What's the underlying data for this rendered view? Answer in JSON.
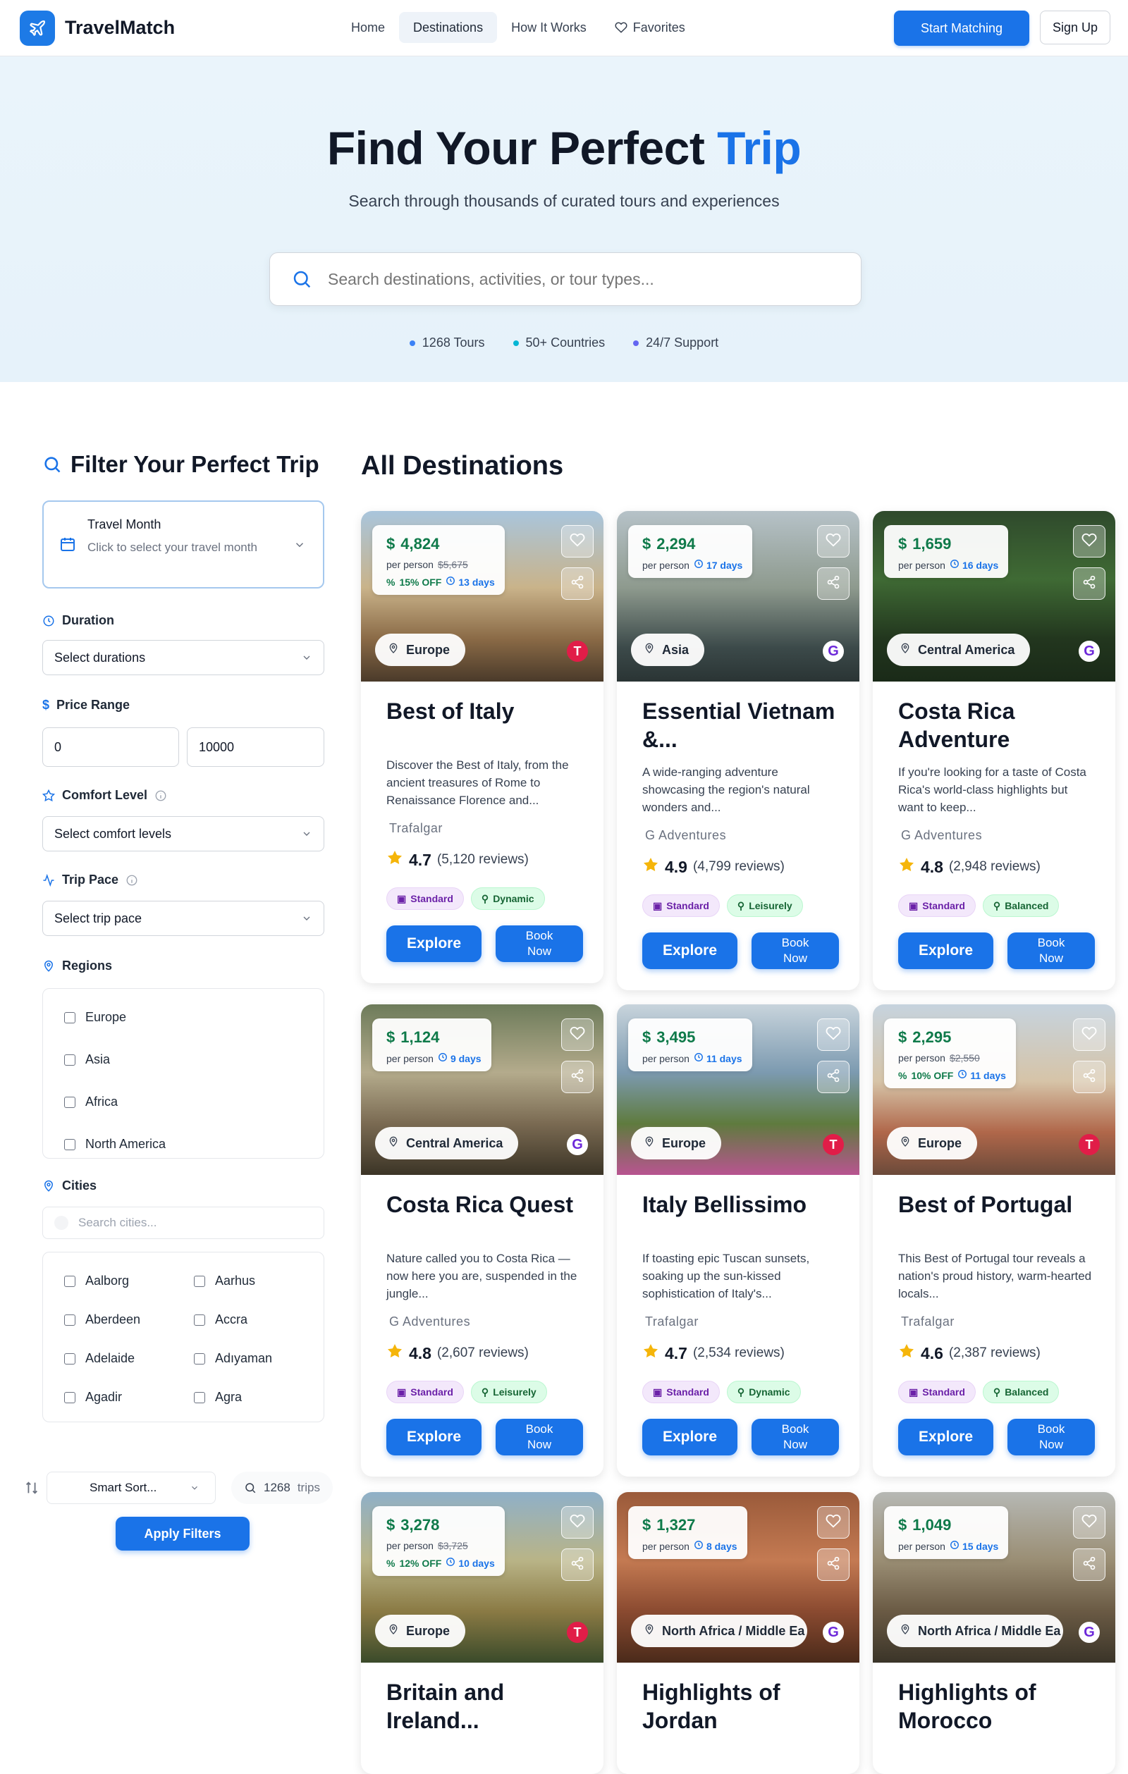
{
  "nav": {
    "brand": "TravelMatch",
    "items": [
      {
        "label": "Home"
      },
      {
        "label": "Destinations"
      },
      {
        "label": "How It Works"
      },
      {
        "label": "Favorites"
      }
    ],
    "cta": "Start Matching",
    "signup": "Sign Up"
  },
  "hero": {
    "title_main": "Find Your Perfect",
    "title_accent": "Trip",
    "subtitle": "Search through thousands of curated tours and experiences",
    "search_placeholder": "Search destinations, activities, or tour types...",
    "stats": [
      {
        "label": "1268 Tours",
        "color": "#3b82f6"
      },
      {
        "label": "50+ Countries",
        "color": "#06b6d4"
      },
      {
        "label": "24/7 Support",
        "color": "#6366f1"
      }
    ]
  },
  "filters": {
    "title": "Filter Your Perfect Trip",
    "travel_month_label": "Travel Month",
    "travel_month_value": "Click to select your travel month",
    "duration_label": "Duration",
    "duration_value": "Select durations",
    "price_label": "Price Range",
    "price_min": "0",
    "price_max": "10000",
    "comfort_label": "Comfort Level",
    "comfort_value": "Select comfort levels",
    "pace_label": "Trip Pace",
    "pace_value": "Select trip pace",
    "regions_label": "Regions",
    "regions": [
      "Europe",
      "Asia",
      "Africa",
      "North America"
    ],
    "cities_label": "Cities",
    "cities_placeholder": "Search cities...",
    "cities": [
      "Aalborg",
      "Aarhus",
      "Aberdeen",
      "Accra",
      "Adelaide",
      "Adıyaman",
      "Agadir",
      "Agra"
    ],
    "sort_value": "Smart Sort...",
    "count_num": "1268",
    "count_unit": "trips",
    "apply": "Apply Filters"
  },
  "main": {
    "title": "All Destinations",
    "explore_label": "Explore",
    "book_label": "Book Now",
    "per_person": "per person"
  },
  "cards": [
    {
      "price": "4,824",
      "old_price": "$5,675",
      "discount": "15% OFF",
      "days": "13 days",
      "region": "Europe",
      "operator_badge": "T",
      "title": "Best of Italy",
      "description": "Discover the Best of Italy, from the ancient treasures of Rome to Renaissance Florence and...",
      "operator": "Trafalgar",
      "rating": "4.7",
      "reviews": "(5,120 reviews)",
      "comfort": "Standard",
      "pace": "Dynamic",
      "theme": "italy"
    },
    {
      "price": "2,294",
      "old_price": "",
      "discount": "",
      "days": "17 days",
      "region": "Asia",
      "operator_badge": "G",
      "title": "Essential Vietnam &...",
      "description": "A wide-ranging adventure showcasing the region's natural wonders and...",
      "operator": "G Adventures",
      "rating": "4.9",
      "reviews": "(4,799 reviews)",
      "comfort": "Standard",
      "pace": "Leisurely",
      "theme": "vietnam"
    },
    {
      "price": "1,659",
      "old_price": "",
      "discount": "",
      "days": "16 days",
      "region": "Central America",
      "operator_badge": "G",
      "title": "Costa Rica Adventure",
      "description": "If you're looking for a taste of Costa Rica's world-class highlights but want to keep...",
      "operator": "G Adventures",
      "rating": "4.8",
      "reviews": "(2,948 reviews)",
      "comfort": "Standard",
      "pace": "Balanced",
      "theme": "forest"
    },
    {
      "price": "1,124",
      "old_price": "",
      "discount": "",
      "days": "9 days",
      "region": "Central America",
      "operator_badge": "G",
      "title": "Costa Rica Quest",
      "description": "Nature called you to Costa Rica — now here you are, suspended in the jungle...",
      "operator": "G Adventures",
      "rating": "4.8",
      "reviews": "(2,607 reviews)",
      "comfort": "Standard",
      "pace": "Leisurely",
      "theme": "quest"
    },
    {
      "price": "3,495",
      "old_price": "",
      "discount": "",
      "days": "11 days",
      "region": "Europe",
      "operator_badge": "T",
      "title": "Italy Bellissimo",
      "description": "If toasting epic Tuscan sunsets, soaking up the sun-kissed sophistication of Italy's...",
      "operator": "Trafalgar",
      "rating": "4.7",
      "reviews": "(2,534 reviews)",
      "comfort": "Standard",
      "pace": "Dynamic",
      "theme": "coast"
    },
    {
      "price": "2,295",
      "old_price": "$2,550",
      "discount": "10% OFF",
      "days": "11 days",
      "region": "Europe",
      "operator_badge": "T",
      "title": "Best of Portugal",
      "description": "This Best of Portugal tour reveals a nation's proud history, warm-hearted locals...",
      "operator": "Trafalgar",
      "rating": "4.6",
      "reviews": "(2,387 reviews)",
      "comfort": "Standard",
      "pace": "Balanced",
      "theme": "portugal"
    },
    {
      "price": "3,278",
      "old_price": "$3,725",
      "discount": "12% OFF",
      "days": "10 days",
      "region": "Europe",
      "operator_badge": "T",
      "title": "Britain and Ireland...",
      "description": "",
      "operator": "",
      "rating": "",
      "reviews": "",
      "comfort": "",
      "pace": "",
      "theme": "britain"
    },
    {
      "price": "1,327",
      "old_price": "",
      "discount": "",
      "days": "8 days",
      "region": "North Africa / Middle Ea",
      "operator_badge": "G",
      "title": "Highlights of Jordan",
      "description": "",
      "operator": "",
      "rating": "",
      "reviews": "",
      "comfort": "",
      "pace": "",
      "theme": "jordan"
    },
    {
      "price": "1,049",
      "old_price": "",
      "discount": "",
      "days": "15 days",
      "region": "North Africa / Middle Ea",
      "operator_badge": "G",
      "title": "Highlights of Morocco",
      "description": "",
      "operator": "",
      "rating": "",
      "reviews": "",
      "comfort": "",
      "pace": "",
      "theme": "morocco"
    }
  ]
}
